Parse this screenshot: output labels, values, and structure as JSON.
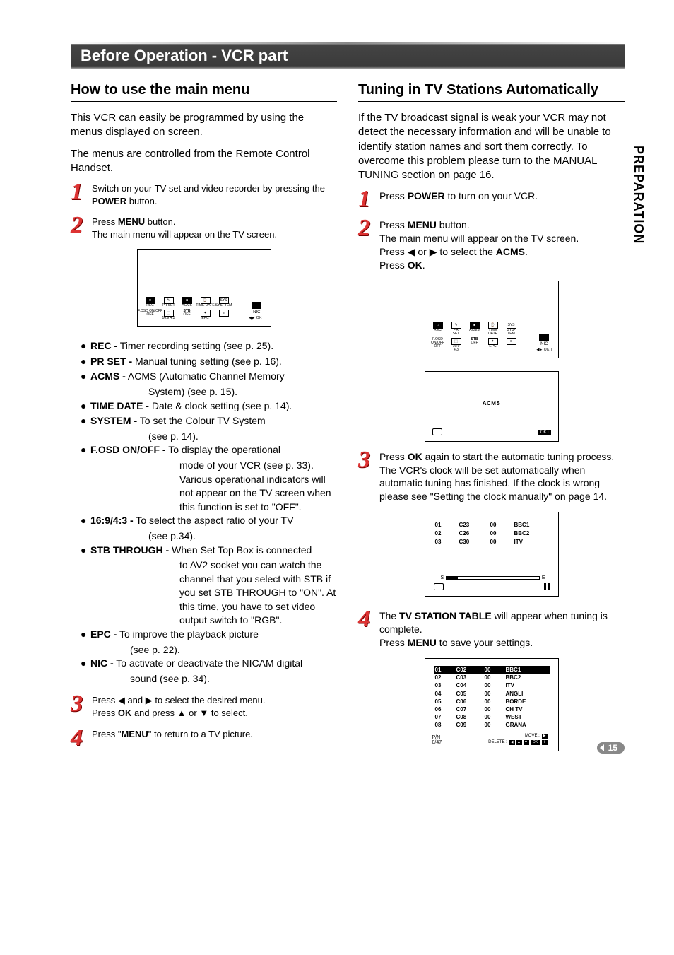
{
  "side_tab": "PREPARATION",
  "page_number": "15",
  "title_bar": "Before Operation - VCR part",
  "left": {
    "heading": "How to use the main menu",
    "intro1": "This VCR can easily be programmed by using the menus displayed on screen.",
    "intro2": "The menus are controlled from the Remote Control Handset.",
    "step1": "Switch on your TV set and video recorder by pressing the POWER button.",
    "step1_bold": "POWER",
    "step2_l1": "Press MENU button.",
    "step2_l2": "The main menu will appear on the TV screen.",
    "step2_bold": "MENU",
    "menu": {
      "rec": "REC - Timer recording setting (see p. 25).",
      "prset": "PR SET - Manual tuning setting (see p. 16).",
      "acms1": "ACMS - ACMS (Automatic Channel Memory",
      "acms2": "System) (see p. 15).",
      "timedate": "TIME DATE - Date & clock setting (see p. 14).",
      "system1": "SYSTEM - To set the Colour TV System",
      "system2": "(see p. 14).",
      "fosd1": "F.OSD ON/OFF - To display the operational",
      "fosd2": "mode of your VCR (see p. 33). Various operational indicators will not appear on the TV screen when this function is set to \"OFF\".",
      "ratio1": "16:9/4:3 - To select the aspect ratio of your TV",
      "ratio2": "(see p.34).",
      "stb1": "STB THROUGH - When Set Top Box is connected",
      "stb2": "to AV2 socket you can watch the channel that you select with STB if you set STB THROUGH to \"ON\". At this time, you have to set video output switch to \"RGB\".",
      "epc1": "EPC - To improve the playback picture",
      "epc2": "(see p. 22).",
      "nic1": "NIC - To activate or deactivate the NICAM digital",
      "nic2": "sound (see p. 34)."
    },
    "step3_l1": "Press ◀ and ▶ to select the desired menu.",
    "step3_l2": "Press OK and press ▲ or ▼ to select.",
    "step3_bold": "OK",
    "step4": "Press \"MENU\" to return to a TV picture.",
    "step4_bold": "MENU",
    "screen_icons": {
      "r1": [
        "REC",
        "PR SET",
        "ACMS",
        "TIME DATE",
        "SYS- TEM"
      ],
      "r2": [
        "F.OSD ON/OFF",
        "16:9 4:3",
        "STB",
        "EPC",
        ""
      ],
      "stb_sub": "OFF",
      "right_lab": "NIC",
      "btns": "◀▶ OK i"
    }
  },
  "right": {
    "heading": "Tuning in TV Stations Automatically",
    "intro": "If the TV broadcast signal is weak your VCR may not detect the necessary information and will be unable to identify station names and sort them correctly. To overcome this problem please turn to the MANUAL TUNING section on page 16.",
    "step1": "Press POWER to turn on your VCR.",
    "step1_bold": "POWER",
    "step2_l1": "Press MENU button.",
    "step2_l2": "The main menu will appear on the TV screen.",
    "step2_l3": "Press ◀ or ▶ to select the ACMS.",
    "step2_l4": "Press OK.",
    "step2_b1": "MENU",
    "step2_b2": "ACMS",
    "step2_b3": "OK",
    "acms_screen_label": "ACMS",
    "acms_screen_ok": "OK i",
    "step3_l1": "Press OK again to start the automatic tuning process.",
    "step3_l2": "The VCR's clock will be set automatically when automatic tuning has finished. If the clock is wrong please see \"Setting the clock manually\" on page 14.",
    "step3_bold": "OK",
    "progress": {
      "rows": [
        {
          "n": "01",
          "ch": "C23",
          "v": "00",
          "name": "BBC1"
        },
        {
          "n": "02",
          "ch": "C26",
          "v": "00",
          "name": "BBC2"
        },
        {
          "n": "03",
          "ch": "C30",
          "v": "00",
          "name": "ITV"
        }
      ],
      "left": "S",
      "right": "E"
    },
    "step4_l1": "The TV STATION TABLE will appear when tuning is complete.",
    "step4_l2": "Press MENU to save your settings.",
    "step4_b1": "TV STATION TABLE",
    "step4_b2": "MENU",
    "table": {
      "rows": [
        {
          "n": "01",
          "ch": "C02",
          "v": "00",
          "name": "BBC1",
          "sel": true
        },
        {
          "n": "02",
          "ch": "C03",
          "v": "00",
          "name": "BBC2"
        },
        {
          "n": "03",
          "ch": "C04",
          "v": "00",
          "name": "ITV"
        },
        {
          "n": "04",
          "ch": "C05",
          "v": "00",
          "name": "ANGLI"
        },
        {
          "n": "05",
          "ch": "C06",
          "v": "00",
          "name": "BORDE"
        },
        {
          "n": "06",
          "ch": "C07",
          "v": "00",
          "name": "CH TV"
        },
        {
          "n": "07",
          "ch": "C08",
          "v": "00",
          "name": "WEST"
        },
        {
          "n": "08",
          "ch": "C09",
          "v": "00",
          "name": "GRANA"
        }
      ],
      "footer_left": "P/N\n0/47",
      "footer_move": "MOVE :",
      "footer_delete": "DELETE :",
      "footer_icons": "◀ ▲ ▼ OK i"
    }
  }
}
